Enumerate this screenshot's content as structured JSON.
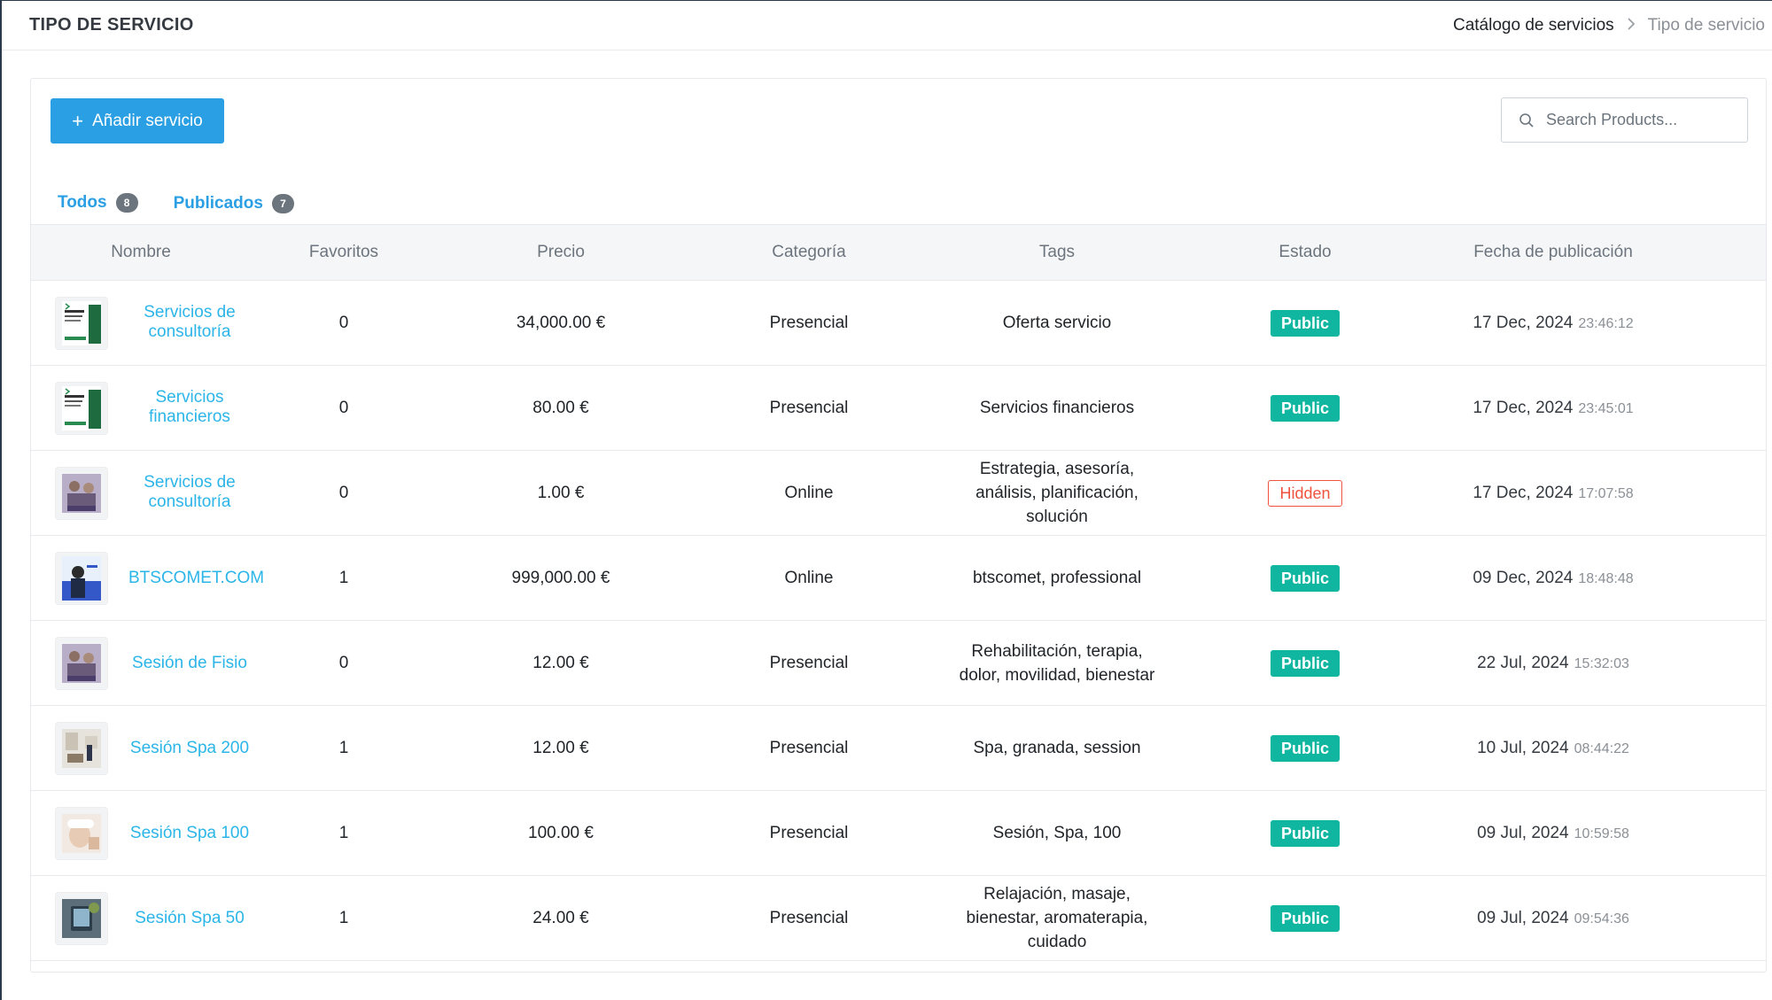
{
  "header": {
    "title": "TIPO DE SERVICIO",
    "breadcrumb": [
      "Catálogo de servicios",
      "Tipo de servicio"
    ]
  },
  "toolbar": {
    "add_button_label": "Añadir servicio",
    "search_placeholder": "Search Products..."
  },
  "tabs": [
    {
      "label": "Todos",
      "count": "8",
      "active": true
    },
    {
      "label": "Publicados",
      "count": "7",
      "active": false
    }
  ],
  "table": {
    "columns": [
      "Nombre",
      "Favoritos",
      "Precio",
      "Categoría",
      "Tags",
      "Estado",
      "Fecha de publicación"
    ],
    "rows": [
      {
        "name": "Servicios de consultoría",
        "favorites": "0",
        "price": "34,000.00 €",
        "category": "Presencial",
        "tags": "Oferta servicio",
        "status": "Public",
        "date": "17 Dec, 2024",
        "time": "23:46:12",
        "thumb": "finance-brochure"
      },
      {
        "name": "Servicios financieros",
        "favorites": "0",
        "price": "80.00 €",
        "category": "Presencial",
        "tags": "Servicios financieros",
        "status": "Public",
        "date": "17 Dec, 2024",
        "time": "23:45:01",
        "thumb": "finance-brochure"
      },
      {
        "name": "Servicios de consultoría",
        "favorites": "0",
        "price": "1.00 €",
        "category": "Online",
        "tags": "Estrategia, asesoría, análisis, planificación, solución",
        "status": "Hidden",
        "date": "17 Dec, 2024",
        "time": "17:07:58",
        "thumb": "meeting-photo"
      },
      {
        "name": "BTSCOMET.COM",
        "favorites": "1",
        "price": "999,000.00 €",
        "category": "Online",
        "tags": "btscomet, professional",
        "status": "Public",
        "date": "09 Dec, 2024",
        "time": "18:48:48",
        "thumb": "business-woman"
      },
      {
        "name": "Sesión de Fisio",
        "favorites": "0",
        "price": "12.00 €",
        "category": "Presencial",
        "tags": "Rehabilitación, terapia, dolor, movilidad, bienestar",
        "status": "Public",
        "date": "22 Jul, 2024",
        "time": "15:32:03",
        "thumb": "meeting-photo"
      },
      {
        "name": "Sesión Spa 200",
        "favorites": "1",
        "price": "12.00 €",
        "category": "Presencial",
        "tags": "Spa, granada, session",
        "status": "Public",
        "date": "10 Jul, 2024",
        "time": "08:44:22",
        "thumb": "office-photo"
      },
      {
        "name": "Sesión Spa 100",
        "favorites": "1",
        "price": "100.00 €",
        "category": "Presencial",
        "tags": "Sesión, Spa, 100",
        "status": "Public",
        "date": "09 Jul, 2024",
        "time": "10:59:58",
        "thumb": "spa-face"
      },
      {
        "name": "Sesión Spa 50",
        "favorites": "1",
        "price": "24.00 €",
        "category": "Presencial",
        "tags": "Relajación, masaje, bienestar, aromaterapia, cuidado",
        "status": "Public",
        "date": "09 Jul, 2024",
        "time": "09:54:36",
        "thumb": "tablet-photo"
      }
    ]
  },
  "colors": {
    "primary": "#2b9fe3",
    "link": "#2bb5e8",
    "public": "#10b6a0",
    "hidden": "#f0533d"
  }
}
